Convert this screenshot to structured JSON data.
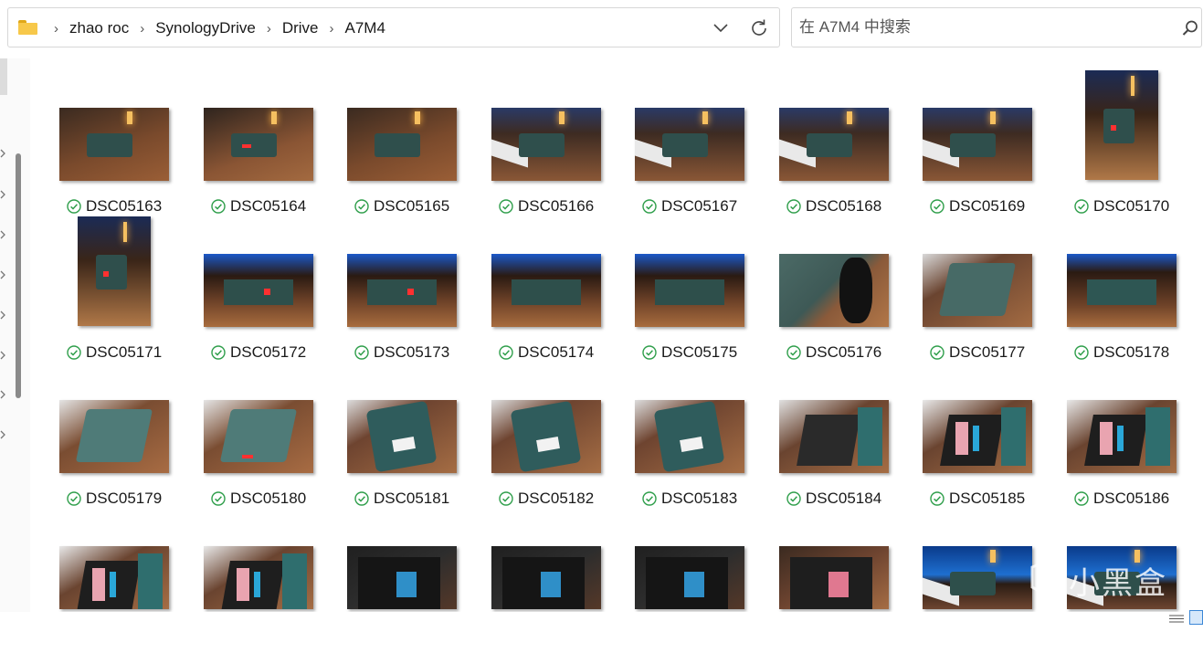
{
  "address": {
    "folder_icon": "folder-icon",
    "segments": [
      "zhao roc",
      "SynologyDrive",
      "Drive",
      "A7M4"
    ],
    "separator": "›"
  },
  "search": {
    "placeholder": "在 A7M4 中搜索",
    "icon": "search-icon"
  },
  "colors": {
    "sync_check": "#2e9e4a",
    "folder": "#f7c84a",
    "accent": "#3b87d6"
  },
  "files": [
    {
      "name": "DSC05163",
      "scene": "desk",
      "orientation": "landscape",
      "status": "synced"
    },
    {
      "name": "DSC05164",
      "scene": "desk-red",
      "orientation": "landscape",
      "status": "synced"
    },
    {
      "name": "DSC05165",
      "scene": "desk",
      "orientation": "landscape",
      "status": "synced"
    },
    {
      "name": "DSC05166",
      "scene": "monitor-desk",
      "orientation": "landscape",
      "status": "synced"
    },
    {
      "name": "DSC05167",
      "scene": "monitor-desk",
      "orientation": "landscape",
      "status": "synced"
    },
    {
      "name": "DSC05168",
      "scene": "monitor-desk",
      "orientation": "landscape",
      "status": "synced"
    },
    {
      "name": "DSC05169",
      "scene": "monitor-desk",
      "orientation": "landscape",
      "status": "synced"
    },
    {
      "name": "DSC05170",
      "scene": "portrait-lamp",
      "orientation": "portrait",
      "status": "synced"
    },
    {
      "name": "DSC05171",
      "scene": "portrait-lamp",
      "orientation": "portrait",
      "status": "synced"
    },
    {
      "name": "DSC05172",
      "scene": "front-ports",
      "orientation": "landscape",
      "status": "synced"
    },
    {
      "name": "DSC05173",
      "scene": "front-ports",
      "orientation": "landscape",
      "status": "synced"
    },
    {
      "name": "DSC05174",
      "scene": "rear-ports",
      "orientation": "landscape",
      "status": "synced"
    },
    {
      "name": "DSC05175",
      "scene": "rear-ports",
      "orientation": "landscape",
      "status": "synced"
    },
    {
      "name": "DSC05176",
      "scene": "mouse-closeup",
      "orientation": "landscape",
      "status": "synced"
    },
    {
      "name": "DSC05177",
      "scene": "box-top",
      "orientation": "landscape",
      "status": "synced"
    },
    {
      "name": "DSC05178",
      "scene": "side-view",
      "orientation": "landscape",
      "status": "synced"
    },
    {
      "name": "DSC05179",
      "scene": "box-angle",
      "orientation": "landscape",
      "status": "synced"
    },
    {
      "name": "DSC05180",
      "scene": "box-angle-red",
      "orientation": "landscape",
      "status": "synced"
    },
    {
      "name": "DSC05181",
      "scene": "bottom-label",
      "orientation": "landscape",
      "status": "synced"
    },
    {
      "name": "DSC05182",
      "scene": "bottom-label",
      "orientation": "landscape",
      "status": "synced"
    },
    {
      "name": "DSC05183",
      "scene": "bottom-label",
      "orientation": "landscape",
      "status": "synced"
    },
    {
      "name": "DSC05184",
      "scene": "open-case",
      "orientation": "landscape",
      "status": "synced"
    },
    {
      "name": "DSC05185",
      "scene": "internals",
      "orientation": "landscape",
      "status": "synced"
    },
    {
      "name": "DSC05186",
      "scene": "internals",
      "orientation": "landscape",
      "status": "synced"
    },
    {
      "name": "",
      "scene": "internals",
      "orientation": "landscape",
      "status": "synced"
    },
    {
      "name": "",
      "scene": "internals",
      "orientation": "landscape",
      "status": "synced"
    },
    {
      "name": "",
      "scene": "board-dark",
      "orientation": "landscape",
      "status": "synced"
    },
    {
      "name": "",
      "scene": "board-dark",
      "orientation": "landscape",
      "status": "synced"
    },
    {
      "name": "",
      "scene": "board-dark",
      "orientation": "landscape",
      "status": "synced"
    },
    {
      "name": "",
      "scene": "board-pink",
      "orientation": "landscape",
      "status": "synced"
    },
    {
      "name": "",
      "scene": "monitor-blue",
      "orientation": "landscape",
      "status": "synced"
    },
    {
      "name": "",
      "scene": "monitor-blue",
      "orientation": "landscape",
      "status": "synced"
    }
  ],
  "watermark": {
    "text": "小黑盒",
    "icon": "xiaoheihe-logo-icon"
  },
  "view_buttons": {
    "details_icon": "details-view-icon",
    "large_icon": "large-icons-view-icon"
  }
}
